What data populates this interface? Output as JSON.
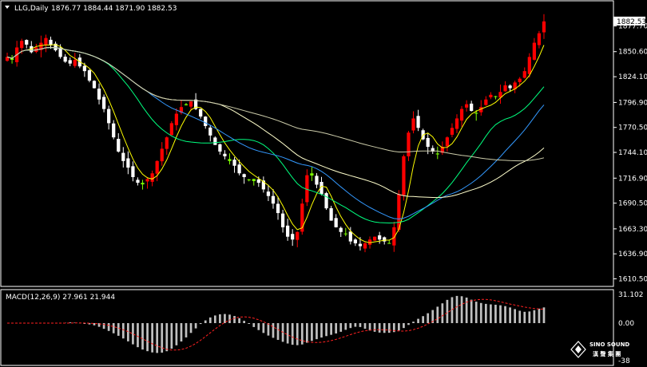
{
  "header": {
    "symbol_label": "LLG,Daily",
    "ohlc_label": "1876.77 1884.44 1871.90 1882.53"
  },
  "macd": {
    "label": "MACD(12,26,9) 27.961 21.944",
    "axis_top": "31.102",
    "axis_zero": "0.00",
    "axis_bottom": "-38"
  },
  "price_axis": {
    "last_price": "1882.53",
    "ticks": [
      "1877.70",
      "1850.60",
      "1824.10",
      "1796.90",
      "1770.50",
      "1744.10",
      "1716.90",
      "1690.50",
      "1663.30",
      "1636.90",
      "1610.50"
    ]
  },
  "watermark": {
    "brand": "SINO SOUND",
    "cn": "漢 聲 集 團"
  },
  "colors": {
    "background": "#000000",
    "bull": "#ff0000",
    "bear": "#ffffff",
    "doji_or_small": "#7cfc00",
    "ma_fast": "#ffff00",
    "ma_mid1": "#00ff7f",
    "ma_mid2": "#3399ff",
    "ma_slow1": "#ffffcc",
    "ma_slow2": "#ccccaa",
    "macd_signal": "#ff2020",
    "macd_hist": "#c0c0c0",
    "axis": "#ffffff"
  },
  "chart_data": {
    "type": "candlestick",
    "symbol": "LLG",
    "timeframe": "Daily",
    "price_range": [
      1610.5,
      1885
    ],
    "closes": [
      1845,
      1842,
      1855,
      1862,
      1858,
      1850,
      1855,
      1860,
      1865,
      1858,
      1852,
      1845,
      1840,
      1838,
      1842,
      1835,
      1830,
      1820,
      1812,
      1800,
      1790,
      1775,
      1760,
      1745,
      1735,
      1728,
      1718,
      1712,
      1712,
      1716,
      1722,
      1735,
      1748,
      1760,
      1775,
      1785,
      1792,
      1795,
      1798,
      1790,
      1782,
      1772,
      1762,
      1752,
      1745,
      1740,
      1735,
      1730,
      1722,
      1718,
      1715,
      1716,
      1712,
      1705,
      1698,
      1690,
      1680,
      1665,
      1655,
      1652,
      1660,
      1690,
      1720,
      1722,
      1710,
      1700,
      1685,
      1672,
      1665,
      1660,
      1658,
      1650,
      1648,
      1645,
      1648,
      1652,
      1655,
      1652,
      1650,
      1648,
      1665,
      1700,
      1740,
      1765,
      1780,
      1770,
      1758,
      1750,
      1745,
      1742,
      1750,
      1760,
      1770,
      1780,
      1790,
      1795,
      1788,
      1785,
      1792,
      1800,
      1805,
      1803,
      1808,
      1815,
      1812,
      1818,
      1822,
      1830,
      1845,
      1860,
      1870,
      1882.53
    ],
    "macd": {
      "last": 27.961,
      "signal": 21.944,
      "axis_max": 31.102,
      "axis_min": -38
    }
  }
}
